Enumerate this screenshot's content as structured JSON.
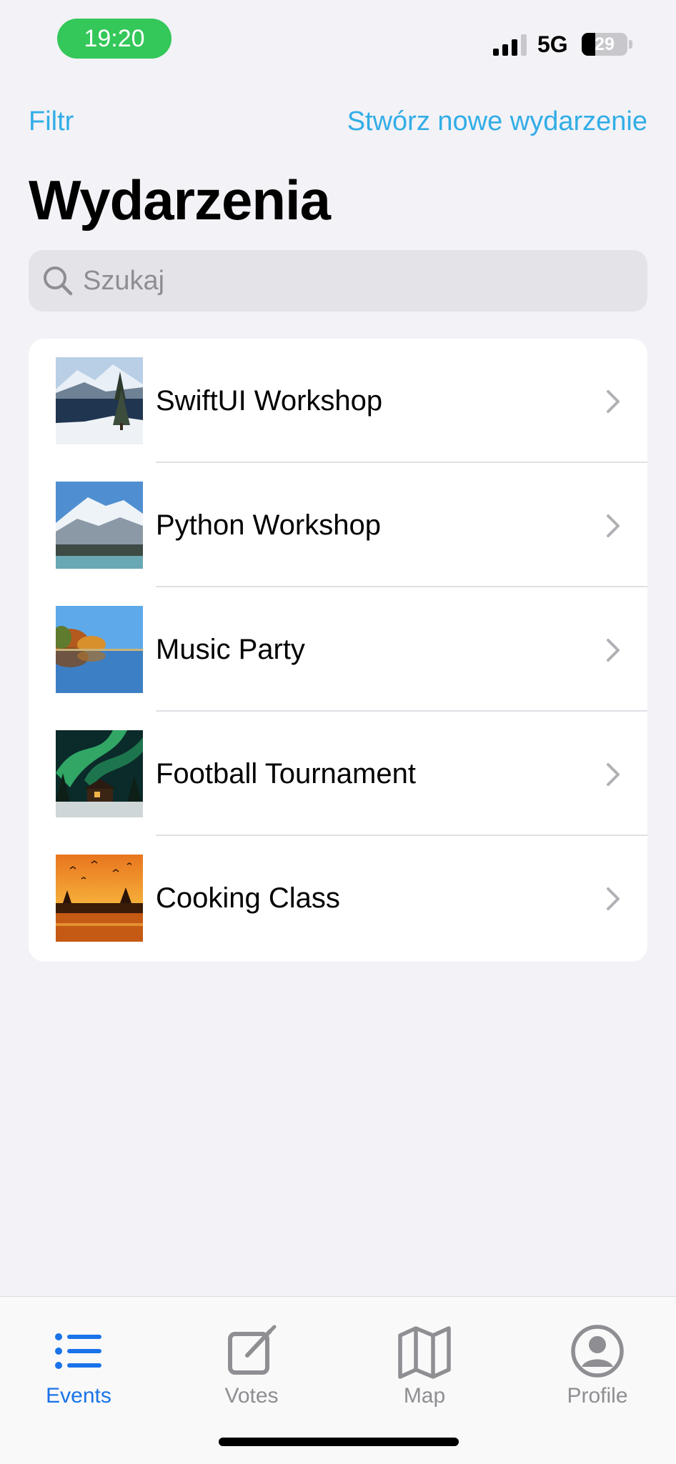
{
  "status_bar": {
    "time": "19:20",
    "network": "5G",
    "battery_level": "29",
    "battery_fraction": 0.29,
    "time_pill_color": "#34c759"
  },
  "nav": {
    "filter_label": "Filtr",
    "create_label": "Stwórz nowe wydarzenie",
    "accent_color": "#32ade6"
  },
  "page": {
    "title": "Wydarzenia"
  },
  "search": {
    "placeholder": "Szukaj",
    "value": "",
    "icon": "magnifying-glass-icon"
  },
  "events": [
    {
      "title": "SwiftUI Workshop",
      "thumbnail": "snowy-lake-mountains"
    },
    {
      "title": "Python Workshop",
      "thumbnail": "snow-mountain-range"
    },
    {
      "title": "Music Party",
      "thumbnail": "autumn-lake-reflection"
    },
    {
      "title": "Football Tournament",
      "thumbnail": "northern-lights-cabin"
    },
    {
      "title": "Cooking Class",
      "thumbnail": "sunset-lake-birds"
    }
  ],
  "tabs": [
    {
      "label": "Events",
      "icon": "list-bullet-icon",
      "active": true
    },
    {
      "label": "Votes",
      "icon": "square-pencil-icon",
      "active": false
    },
    {
      "label": "Map",
      "icon": "map-icon",
      "active": false
    },
    {
      "label": "Profile",
      "icon": "person-circle-icon",
      "active": false
    }
  ],
  "colors": {
    "active_tab": "#1a73e8",
    "inactive_tab": "#8e8e93",
    "background": "#f2f2f7"
  }
}
